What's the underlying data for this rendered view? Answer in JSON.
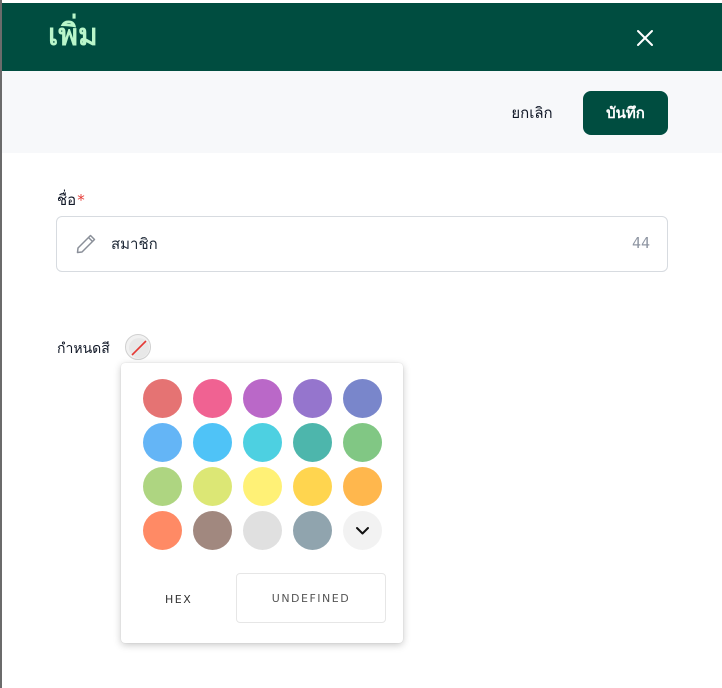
{
  "dialog": {
    "title": "เพิ่ม",
    "cancel_label": "ยกเลิก",
    "save_label": "บันทึก"
  },
  "form": {
    "name_label": "ชื่อ",
    "required_mark": "*",
    "name_value": "สมาชิก",
    "char_counter": "44",
    "color_label": "กำหนดสี"
  },
  "color_picker": {
    "swatches": [
      "#e57373",
      "#f06292",
      "#ba68c8",
      "#9575cd",
      "#7986cb",
      "#64b5f6",
      "#4fc3f7",
      "#4dd0e1",
      "#4db6ac",
      "#81c784",
      "#aed581",
      "#dce775",
      "#fff176",
      "#ffd54f",
      "#ffb74d",
      "#ff8a65",
      "#a1887f",
      "#e0e0e0",
      "#90a4ae"
    ],
    "hex_label": "HEX",
    "hex_value": "UNDEFINED",
    "more_icon": "chevron-down-icon"
  },
  "theme": {
    "header_bg": "#004d40",
    "title_color": "#b9f6ca",
    "save_bg": "#004d40",
    "required_color": "#e53935"
  }
}
